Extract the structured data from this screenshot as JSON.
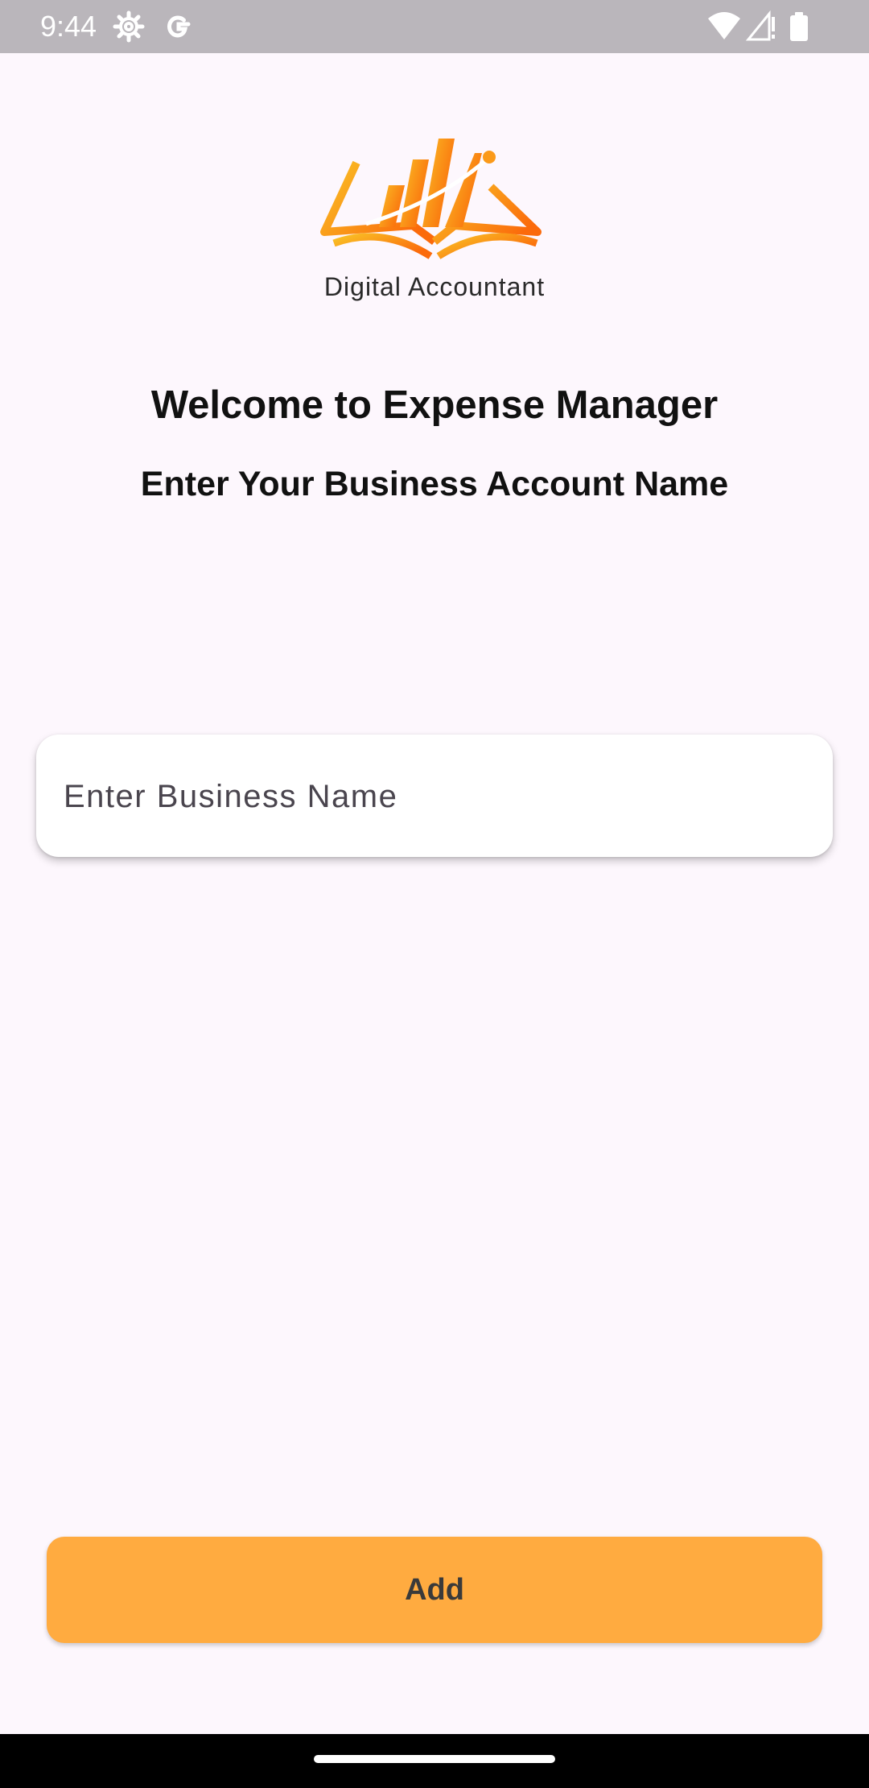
{
  "status_bar": {
    "time": "9:44",
    "left_icons": [
      "settings-icon",
      "google-icon"
    ],
    "right_icons": [
      "wifi-icon",
      "cell-signal-icon",
      "battery-icon"
    ]
  },
  "logo": {
    "text": "Digital Accountant",
    "gradient_colors": [
      "#f9c226",
      "#fb6a0b"
    ]
  },
  "heading": {
    "title": "Welcome to Expense Manager",
    "subtitle": "Enter Your Business Account Name"
  },
  "business_input": {
    "placeholder": "Enter Business Name",
    "value": ""
  },
  "add_button": {
    "label": "Add",
    "color": "#ffab40"
  },
  "colors": {
    "background": "#fdf7fd",
    "status_bar": "#bab6bb"
  }
}
